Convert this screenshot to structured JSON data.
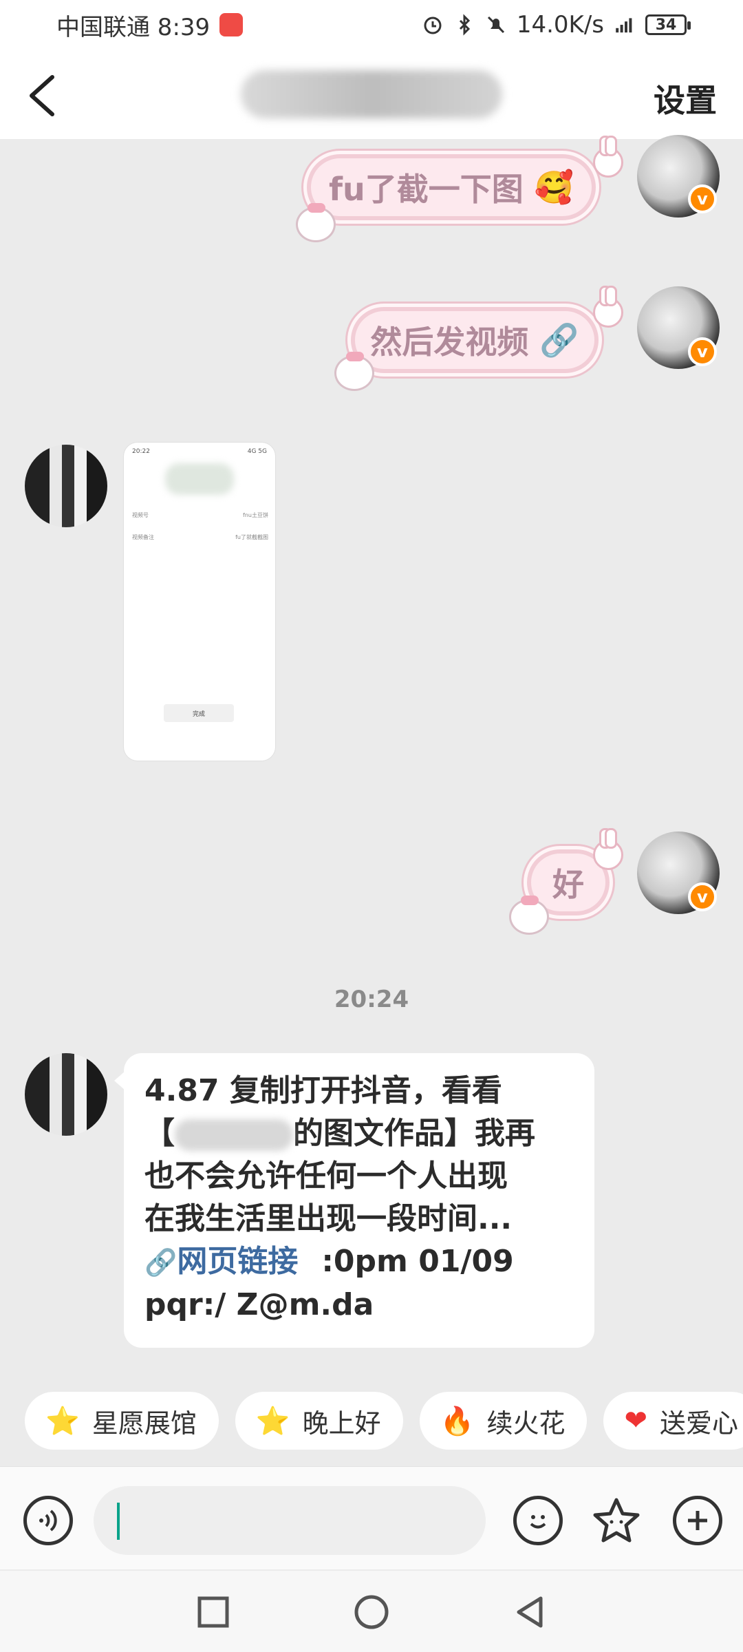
{
  "status_bar": {
    "carrier_time": "中国联通 8:39",
    "network_speed": "14.0K/s",
    "battery": "34"
  },
  "header": {
    "settings_label": "设置"
  },
  "messages": [
    {
      "side": "right",
      "text": "fu了截一下图",
      "emoji": "🥰"
    },
    {
      "side": "right",
      "text": "然后发视频",
      "emoji": "🔗"
    },
    {
      "side": "right",
      "text": "好"
    }
  ],
  "screenshot_thumb": {
    "time": "20:22",
    "status_right": "4G 5G",
    "row1_left": "视频号",
    "row1_right": "fnu土豆饼",
    "row2_left": "视频备注",
    "row2_right": "fu了就截截图",
    "button": "完成"
  },
  "timestamp": "20:24",
  "share_message": {
    "line1": "4.87 复制打开抖音，看看",
    "line2_prefix": "【",
    "line2_suffix": "的图文作品】我再",
    "line3": "也不会允许任何一个人出现",
    "line4": "在我生活里出现一段时间...",
    "link_label": "网页链接",
    "line5_rest": ":0pm 01/09",
    "line6": "pqr:/ Z@m.da"
  },
  "quick_replies": [
    {
      "icon": "⭐",
      "label": "星愿展馆"
    },
    {
      "icon": "⭐",
      "label": "晚上好"
    },
    {
      "icon": "🔥",
      "label": "续火花"
    },
    {
      "icon": "❤",
      "label": "送爱心"
    }
  ],
  "colors": {
    "link": "#3d6aa0",
    "badge": "#ff8a00",
    "caret": "#0aa38a"
  }
}
